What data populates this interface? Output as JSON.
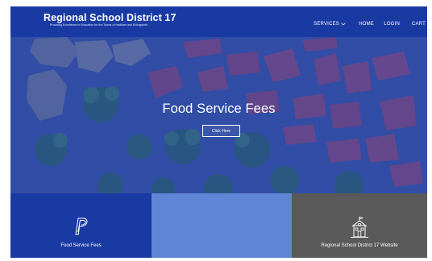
{
  "header": {
    "title": "Regional School District 17",
    "tagline": "Providing Excellence in Education for the Towns of Haddam and Killingworth"
  },
  "nav": {
    "services": "SERVICES",
    "home": "HOME",
    "login": "LOGIN",
    "cart": "CART"
  },
  "hero": {
    "title": "Food Service Fees",
    "cta": "Click Here"
  },
  "tiles": [
    {
      "label": "Food Service Fees",
      "icon": "paypal-icon"
    },
    {
      "label": ""
    },
    {
      "label": "Regional School District 17 Website",
      "icon": "schoolhouse-icon"
    }
  ],
  "colors": {
    "header_bg": "#1a3aa3",
    "tile_blue": "#1a3aa3",
    "tile_light_blue": "#5f85d6",
    "tile_gray": "#5a5a5a",
    "hero_overlay": "#233aa0"
  }
}
